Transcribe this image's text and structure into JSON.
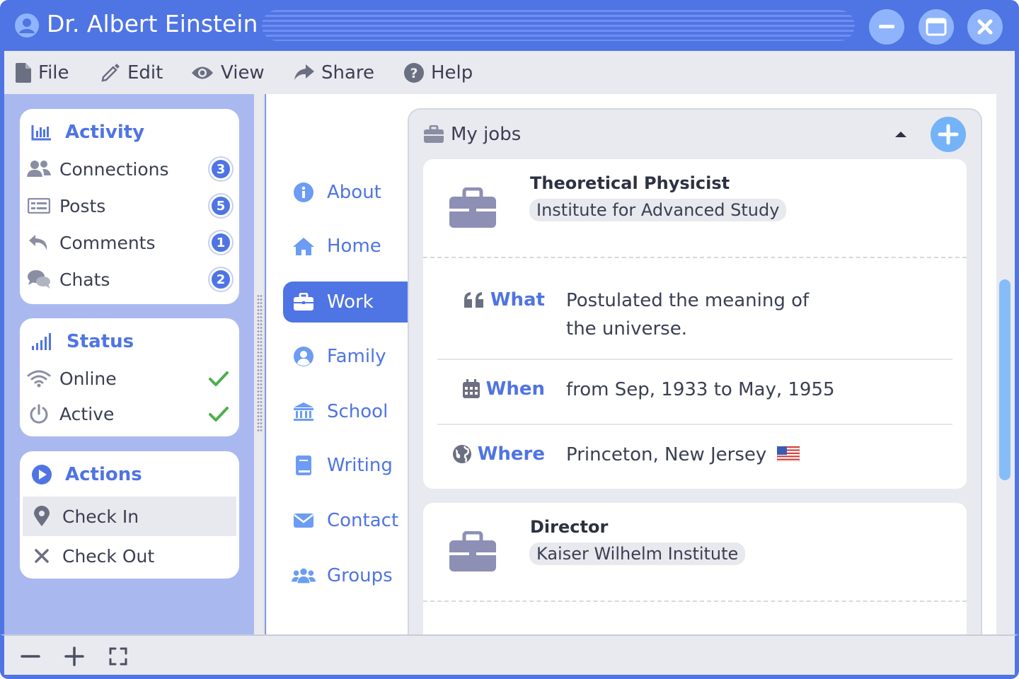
{
  "window": {
    "title": "Dr. Albert Einstein",
    "colors": {
      "accent": "#4f74e3",
      "window_button": "#8fb4fb",
      "add_button": "#74b3f7",
      "check": "#4caf50"
    }
  },
  "menu": [
    {
      "label": "File",
      "icon": "file-icon"
    },
    {
      "label": "Edit",
      "icon": "pencil-icon"
    },
    {
      "label": "View",
      "icon": "eye-icon"
    },
    {
      "label": "Share",
      "icon": "share-icon"
    },
    {
      "label": "Help",
      "icon": "help-icon"
    }
  ],
  "sidebar": {
    "activity": {
      "title": "Activity",
      "items": [
        {
          "label": "Connections",
          "count": "3",
          "icon": "users-icon"
        },
        {
          "label": "Posts",
          "count": "5",
          "icon": "posts-icon"
        },
        {
          "label": "Comments",
          "count": "1",
          "icon": "reply-icon"
        },
        {
          "label": "Chats",
          "count": "2",
          "icon": "chat-icon"
        }
      ]
    },
    "status": {
      "title": "Status",
      "items": [
        {
          "label": "Online",
          "checked": true,
          "icon": "wifi-icon"
        },
        {
          "label": "Active",
          "checked": true,
          "icon": "power-icon"
        }
      ]
    },
    "actions": {
      "title": "Actions",
      "items": [
        {
          "label": "Check In",
          "icon": "map-pin-icon",
          "highlighted": true
        },
        {
          "label": "Check Out",
          "icon": "x-icon"
        }
      ]
    }
  },
  "nav": {
    "active": "Work",
    "items": [
      {
        "label": "About",
        "icon": "info-icon"
      },
      {
        "label": "Home",
        "icon": "home-icon"
      },
      {
        "label": "Work",
        "icon": "briefcase-icon"
      },
      {
        "label": "Family",
        "icon": "user-circle-icon"
      },
      {
        "label": "School",
        "icon": "institution-icon"
      },
      {
        "label": "Writing",
        "icon": "book-icon"
      },
      {
        "label": "Contact",
        "icon": "envelope-icon"
      },
      {
        "label": "Groups",
        "icon": "groups-icon"
      }
    ]
  },
  "jobs": {
    "title": "My jobs",
    "items": [
      {
        "role": "Theoretical Physicist",
        "organization": "Institute for Advanced Study",
        "details": {
          "what_label": "What",
          "what": "Postulated the meaning of the universe.",
          "when_label": "When",
          "when": "from Sep, 1933 to May, 1955",
          "where_label": "Where",
          "where": "Princeton, New Jersey"
        }
      },
      {
        "role": "Director",
        "organization": "Kaiser Wilhelm Institute"
      }
    ]
  }
}
